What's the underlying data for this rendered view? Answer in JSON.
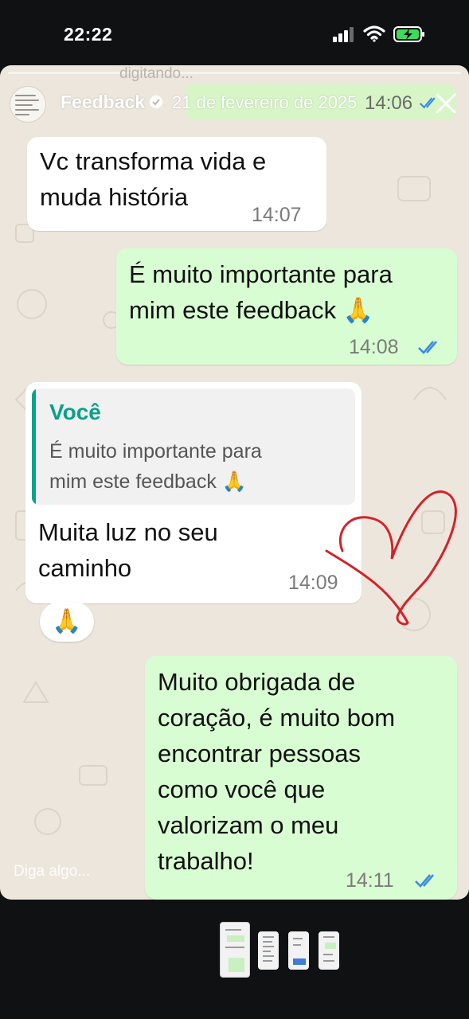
{
  "status_bar": {
    "time": "22:22"
  },
  "story": {
    "title": "Feedback",
    "date": "21 de fevereiro de 2025",
    "top_blur_text": "digitando...",
    "peek_time": "14:06",
    "input_placeholder": "Diga algo..."
  },
  "messages": [
    {
      "side": "incoming",
      "text_lines": [
        "Vc transforma vida e",
        "muda história"
      ],
      "time": "14:07"
    },
    {
      "side": "outgoing",
      "text_lines": [
        "É muito importante para",
        "mim este feedback 🙏"
      ],
      "time": "14:08"
    },
    {
      "side": "incoming",
      "quote_author": "Você",
      "quote_lines": [
        "É muito importante para",
        "mim este feedback 🙏"
      ],
      "text_lines": [
        "Muita luz  no seu",
        "caminho"
      ],
      "time": "14:09"
    },
    {
      "side": "outgoing",
      "text_lines": [
        "Muito obrigada de",
        "coração, é muito bom",
        "encontrar pessoas",
        "como você que",
        "valorizam o meu",
        "trabalho!"
      ],
      "time": "14:11"
    }
  ],
  "reaction": "🙏",
  "colors": {
    "background": "#0f1113",
    "chat_bg": "#ede6dc",
    "incoming_bubble": "#ffffff",
    "outgoing_bubble": "#d9fdd3",
    "tick_blue": "#3a8be8",
    "quote_accent": "#06a48a",
    "heart_red": "#d2232a"
  },
  "icons": [
    "signal-icon",
    "wifi-icon",
    "battery-charging-icon",
    "verified-icon",
    "close-icon",
    "double-check-icon",
    "heart-doodle"
  ]
}
